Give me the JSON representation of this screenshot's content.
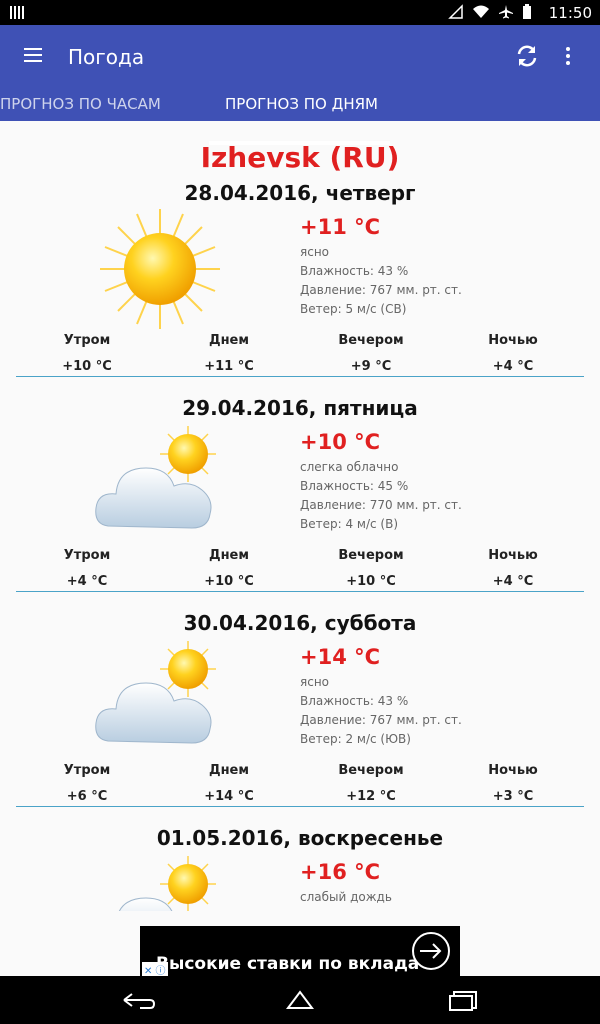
{
  "status": {
    "time": "11:50"
  },
  "app": {
    "title": "Погода"
  },
  "tabs": [
    {
      "label": "ПРОГНОЗ ПО ЧАСАМ"
    },
    {
      "label": "ПРОГНОЗ ПО ДНЯМ"
    }
  ],
  "city": "Izhevsk (RU)",
  "days": [
    {
      "date": "28.04.2016, четверг",
      "icon": "sun-icon",
      "temp": "+11 °C",
      "condition": "ясно",
      "humidity": "Влажность: 43 %",
      "pressure": "Давление: 767 мм. рт. ст.",
      "wind": "Ветер: 5 м/с (СВ)",
      "periods": [
        {
          "name": "Утром",
          "value": "+10 °C"
        },
        {
          "name": "Днем",
          "value": "+11 °C"
        },
        {
          "name": "Вечером",
          "value": "+9 °C"
        },
        {
          "name": "Ночью",
          "value": "+4 °C"
        }
      ]
    },
    {
      "date": "29.04.2016, пятница",
      "icon": "partly-cloudy-icon",
      "temp": "+10 °C",
      "condition": "слегка облачно",
      "humidity": "Влажность: 45 %",
      "pressure": "Давление: 770 мм. рт. ст.",
      "wind": "Ветер: 4 м/с (В)",
      "periods": [
        {
          "name": "Утром",
          "value": "+4 °C"
        },
        {
          "name": "Днем",
          "value": "+10 °C"
        },
        {
          "name": "Вечером",
          "value": "+10 °C"
        },
        {
          "name": "Ночью",
          "value": "+4 °C"
        }
      ]
    },
    {
      "date": "30.04.2016, суббота",
      "icon": "partly-cloudy-icon",
      "temp": "+14 °C",
      "condition": "ясно",
      "humidity": "Влажность: 43 %",
      "pressure": "Давление: 767 мм. рт. ст.",
      "wind": "Ветер: 2 м/с (ЮВ)",
      "periods": [
        {
          "name": "Утром",
          "value": "+6 °C"
        },
        {
          "name": "Днем",
          "value": "+14 °C"
        },
        {
          "name": "Вечером",
          "value": "+12 °C"
        },
        {
          "name": "Ночью",
          "value": "+3 °C"
        }
      ]
    },
    {
      "date": "01.05.2016, воскресенье",
      "icon": "partly-cloudy-icon",
      "temp": "+16 °C",
      "condition": "слабый дождь"
    }
  ],
  "ad": {
    "text": "Высокие ставки по вклада"
  },
  "colors": {
    "appbar": "#3f51b5",
    "accent": "#e02020",
    "divider": "#4aa3c8"
  }
}
